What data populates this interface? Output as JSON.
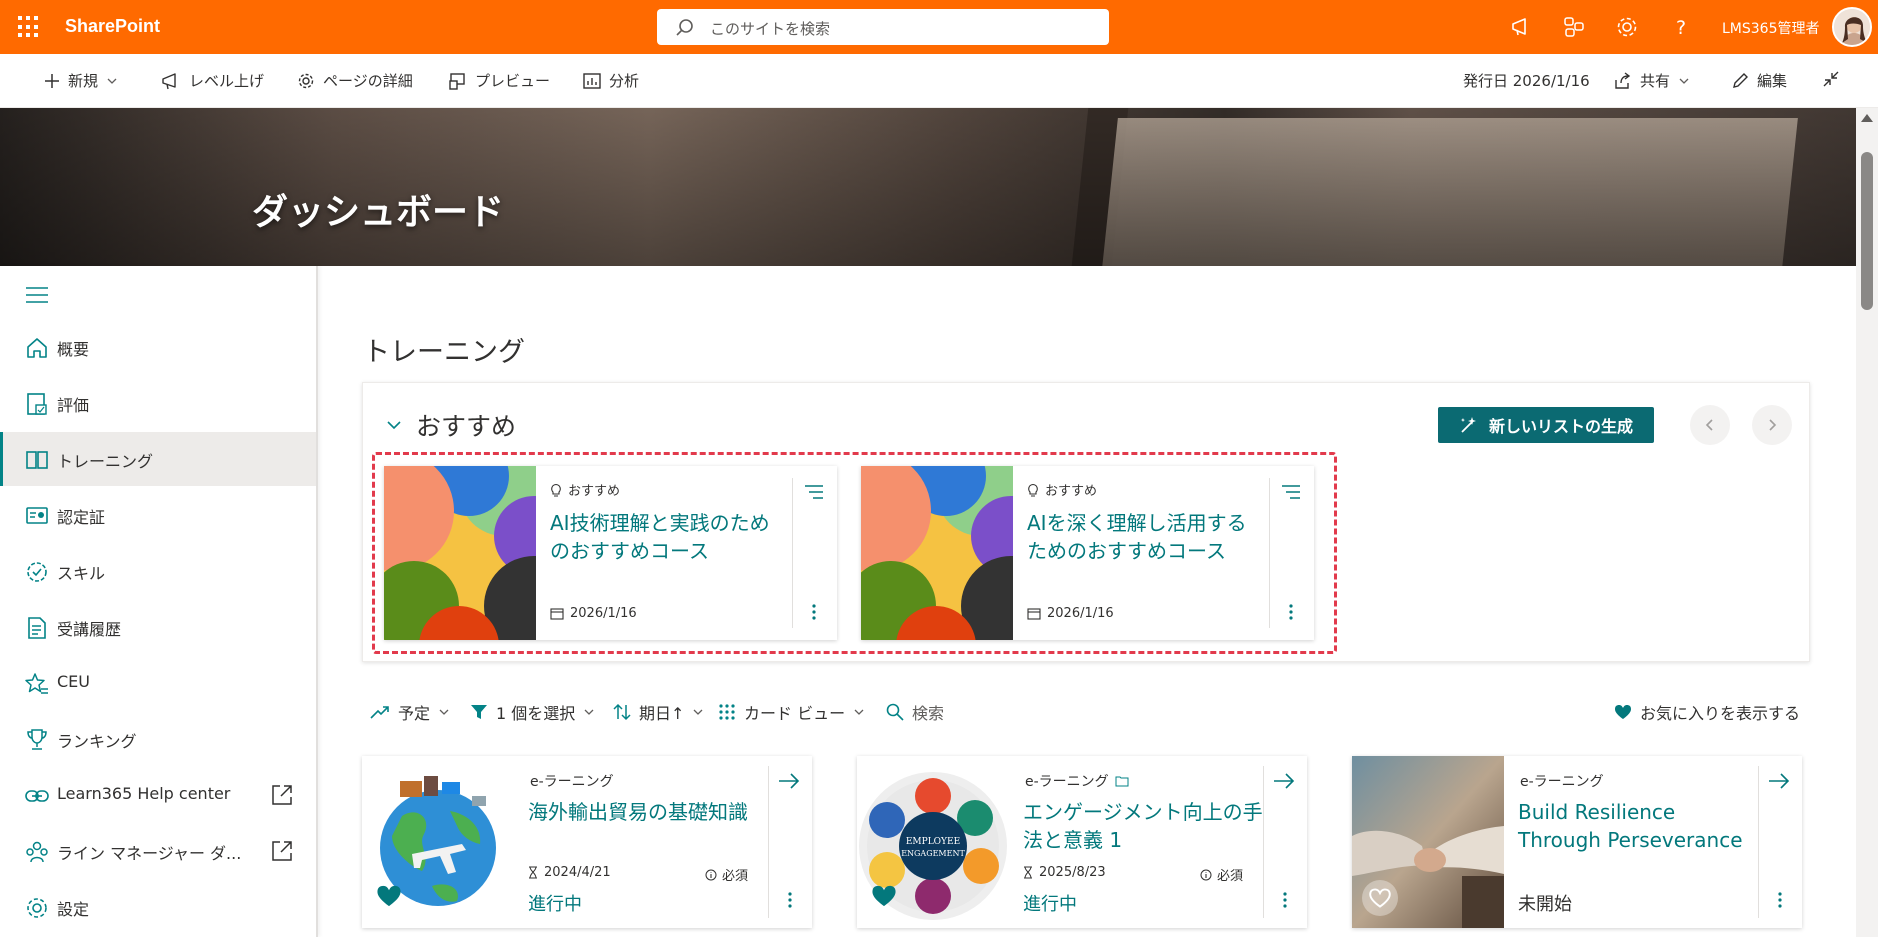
{
  "suite": {
    "app_name": "SharePoint",
    "search_placeholder": "このサイトを検索",
    "user_name": "LMS365管理者",
    "icons": [
      "megaphone-icon",
      "share-network-icon",
      "gear-icon",
      "help-icon"
    ]
  },
  "command_bar": {
    "new_label": "新規",
    "promote_label": "レベル上げ",
    "page_details_label": "ページの詳細",
    "preview_label": "プレビュー",
    "analytics_label": "分析",
    "published_label": "発行日 2026/1/16",
    "share_label": "共有",
    "edit_label": "編集"
  },
  "banner": {
    "title": "ダッシュボード"
  },
  "nav": {
    "items": [
      {
        "label": "概要",
        "icon": "home-icon"
      },
      {
        "label": "評価",
        "icon": "assessment-icon"
      },
      {
        "label": "トレーニング",
        "icon": "book-icon",
        "active": true
      },
      {
        "label": "認定証",
        "icon": "certificate-icon"
      },
      {
        "label": "スキル",
        "icon": "skill-badge-icon"
      },
      {
        "label": "受講履歴",
        "icon": "history-document-icon"
      },
      {
        "label": "CEU",
        "icon": "star-list-icon"
      },
      {
        "label": "ランキング",
        "icon": "trophy-icon"
      },
      {
        "label": "Learn365 Help center",
        "icon": "link-icon"
      },
      {
        "label": "ライン マネージャー ダ...",
        "icon": "people-icon"
      },
      {
        "label": "設定",
        "icon": "gear-icon"
      }
    ]
  },
  "training": {
    "section_title": "トレーニング",
    "recommended_title": "おすすめ",
    "generate_label": "新しいリストの生成",
    "recommended_cards": [
      {
        "kind": "おすすめ",
        "title": "AI技術理解と実践のためのおすすめコース",
        "date": "2026/1/16"
      },
      {
        "kind": "おすすめ",
        "title": "AIを深く理解し活用するためのおすすめコース",
        "date": "2026/1/16"
      }
    ],
    "toolbar": {
      "sort_scope": "予定",
      "filter": "1 個を選択",
      "sort_by": "期日↑",
      "view": "カード ビュー",
      "search": "検索",
      "favorites": "お気に入りを表示する"
    },
    "courses": [
      {
        "type": "e-ラーニング",
        "title": "海外輸出貿易の基礎知識",
        "due": "2024/4/21",
        "required": "必須",
        "status": "進行中",
        "favorite": true
      },
      {
        "type": "e-ラーニング",
        "title": "エンゲージメント向上の手法と意義 1",
        "due": "2025/8/23",
        "required": "必須",
        "status": "進行中",
        "favorite": true
      },
      {
        "type": "e-ラーニング",
        "title": "Build Resilience Through Perseverance",
        "due": "",
        "required": "",
        "status": "未開始",
        "favorite": false
      }
    ],
    "engagement_thumb_text": "EMPLOYEE ENGAGEMENT"
  },
  "colors": {
    "suite_bar": "#ff6a00",
    "accent_teal": "#03787c",
    "button_teal": "#0b6a72",
    "highlight_dashed": "#e23a4c"
  }
}
